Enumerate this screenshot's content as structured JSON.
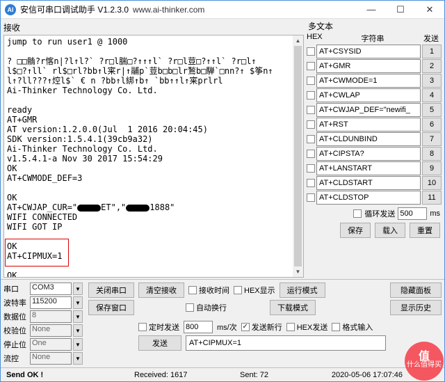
{
  "titlebar": {
    "title": "安信可串口调试助手  V1.2.3.0",
    "url": "www.ai-thinker.com"
  },
  "left": {
    "label": "接收"
  },
  "recv": {
    "l1": "jump to run user1 @ 1000",
    "l2": "",
    "l3": "? □□䯚?r愘n|?l↑l?` ?r□l腨□?↑↑↑l` ?r□l荳□?↑↑l` ?r□l↑",
    "l4": "l$□?↑ll` rl$□rl?bb↑l宷r|↑鬴p`荳b□b□lr鶖b□騨`□nn?↑ $筝n↑",
    "l5": "l↑?ll???↑焢l$` € n ?bb↑l綁↑b↑ `bb↑↑l↑宷prlrl",
    "l6": "Ai-Thinker Technology Co. Ltd.",
    "l7": "",
    "l8": "ready",
    "l9": "AT+GMR",
    "l10": "AT version:1.2.0.0(Jul  1 2016 20:04:45)",
    "l11": "SDK version:1.5.4.1(39cb9a32)",
    "l12": "Ai-Thinker Technology Co. Ltd.",
    "l13": "v1.5.4.1-a Nov 30 2017 15:54:29",
    "l14": "OK",
    "l15": "AT+CWMODE_DEF=3",
    "l16": "",
    "l17": "OK",
    "l18a": "AT+CWJAP_CUR=\"",
    "l18b": "ET\",\"",
    "l18c": "1888\"",
    "l19": "WIFI CONNECTED",
    "l20": "WIFI GOT IP",
    "l21": "",
    "l22": "OK",
    "l23": "AT+CIPMUX=1",
    "l24": "",
    "l25": "OK"
  },
  "multi": {
    "label": "多文本",
    "hex": "HEX",
    "string": "字符串",
    "send": "发送",
    "rows": [
      {
        "v": "AT+CSYSID",
        "n": "1"
      },
      {
        "v": "AT+GMR",
        "n": "2"
      },
      {
        "v": "AT+CWMODE=1",
        "n": "3"
      },
      {
        "v": "AT+CWLAP",
        "n": "4"
      },
      {
        "v": "AT+CWJAP_DEF=\"newifi_",
        "n": "5"
      },
      {
        "v": "AT+RST",
        "n": "6"
      },
      {
        "v": "AT+CLDUNBIND",
        "n": "7"
      },
      {
        "v": "AT+CIPSTA?",
        "n": "8"
      },
      {
        "v": "AT+LANSTART",
        "n": "9"
      },
      {
        "v": "AT+CLDSTART",
        "n": "10"
      },
      {
        "v": "AT+CLDSTOP",
        "n": "11"
      }
    ],
    "loop": "循环发送",
    "loopval": "500",
    "ms": "ms",
    "save": "保存",
    "load": "载入",
    "reset": "重置"
  },
  "port": {
    "labels": {
      "port": "串口",
      "baud": "波特率",
      "databits": "数据位",
      "parity": "校验位",
      "stopbits": "停止位",
      "flow": "流控"
    },
    "values": {
      "port": "COM3",
      "baud": "115200",
      "databits": "8",
      "parity": "None",
      "stopbits": "One",
      "flow": "None"
    }
  },
  "ctrl": {
    "close": "关闭串口",
    "save": "保存窗口",
    "clear": "清空接收",
    "recvtime": "接收时间",
    "hexdisp": "HEX显示",
    "run": "运行模式",
    "hidepanel": "隐藏面板",
    "autowrap": "自动换行",
    "download": "下载模式",
    "history": "显示历史",
    "timed": "定时发送",
    "timedval": "800",
    "msper": "ms/次",
    "newline": "发送新行",
    "hexsend": "HEX发送",
    "fmtinput": "格式输入",
    "send": "发送",
    "sendval": "AT+CIPMUX=1"
  },
  "status": {
    "ok": "Send OK !",
    "recv": "Received: 1617",
    "sent": "Sent: 72",
    "time": "2020-05-06 17:07:46"
  },
  "watermark": {
    "l1": "值",
    "l2": "什么值得买"
  }
}
